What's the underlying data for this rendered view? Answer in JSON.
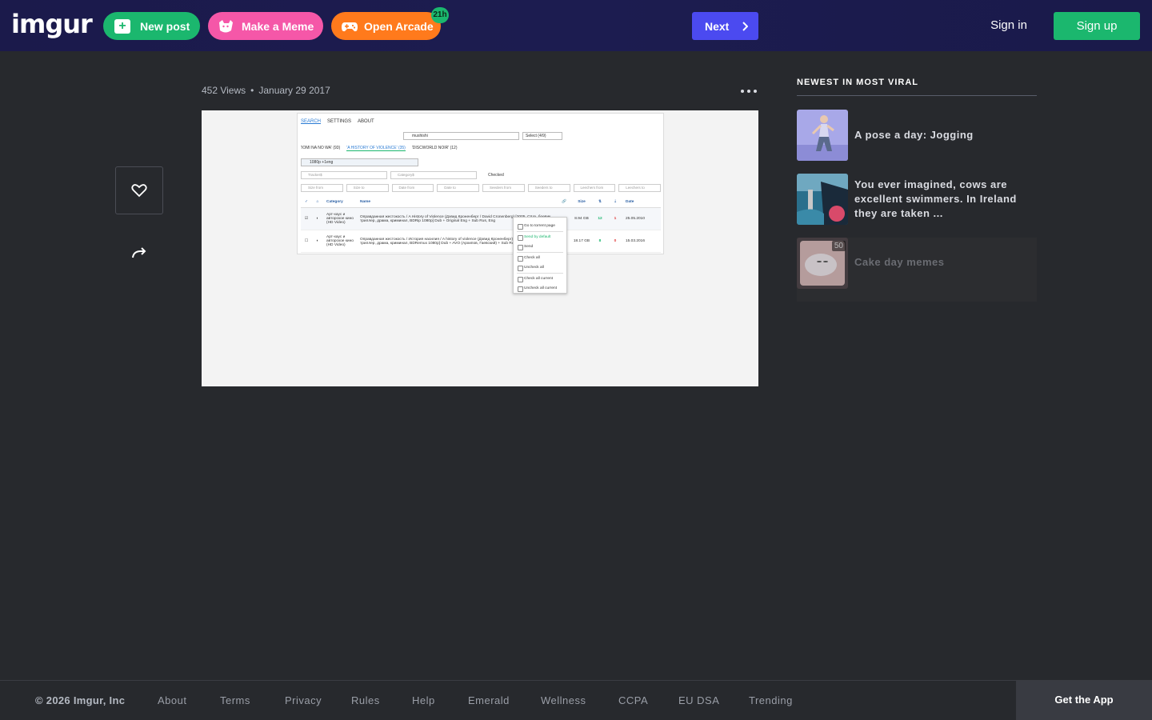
{
  "header": {
    "logo": "imgur",
    "new_post_label": "New post",
    "meme_label": "Make a Meme",
    "arcade_label": "Open Arcade",
    "arcade_badge": "21h",
    "next_label": "Next",
    "signin_label": "Sign in",
    "signup_label": "Sign up"
  },
  "post": {
    "views": "452 Views",
    "separator": "•",
    "date": "January 29 2017",
    "screenshot": {
      "tabs": [
        "SEARCH",
        "SETTINGS",
        "ABOUT"
      ],
      "search_value": "mushishi",
      "select_label": "Select (4/9)",
      "categories": [
        "'IOMI NA NO WA' (93)",
        "'A HISTORY OF VIOLENCE' (35)",
        "'DISCWORLD NOIR' (12)"
      ],
      "filter_value": "1080p +1eng",
      "checked_label": "Checked",
      "filter_row1": [
        "Tracker$",
        "Category$"
      ],
      "filter_row2": [
        "Size from",
        "Size to",
        "Date from",
        "Date to",
        "Seeders from",
        "Seeders to",
        "Leechers from",
        "Leechers to"
      ],
      "columns": [
        "Category",
        "Name",
        "Size",
        "Date"
      ],
      "rows": [
        {
          "category": "Арт-хаус и авторское кино (HD Video)",
          "name": "Оправданная жестокость / A History of Violence (Дэвид Кроненберг / David Cronenberg) [2005, США, боевик, триллер, драма, криминал, BDRip 1080p] Dub + Original Eng + Sub Rus, Eng",
          "size": "8.94 GB",
          "seeds": "12",
          "leech": "1",
          "date": "25.05.2010"
        },
        {
          "category": "Арт-хаус и авторское кино (HD Video)",
          "name": "Оправданная жестокость / История насилия / A history of violence (Дэвид Кроненберг) [2005, США, Германия, триллер, драма, криминал, BDRemux 1080p] Dub + AVO (Архипов, Гаевский) + Sub Rus, Eng + Original Eng",
          "size": "18.17 GB",
          "seeds": "8",
          "leech": "0",
          "date": "15.03.2016"
        }
      ],
      "context_menu": [
        "Go to torrent page",
        "Send by default",
        "Send",
        "Check all",
        "Uncheck all",
        "Check all current",
        "Uncheck all current"
      ]
    }
  },
  "sidebar": {
    "title": "NEWEST IN MOST VIRAL",
    "items": [
      {
        "title": "A pose a day: Jogging"
      },
      {
        "title": "You ever imagined, cows are excellent swimmers. In Ireland they are taken ..."
      },
      {
        "title": "Cake day memes",
        "count": "50"
      }
    ]
  },
  "footer": {
    "copyright": "© 2026 Imgur, Inc",
    "links": [
      "About",
      "Terms",
      "Privacy",
      "Rules",
      "Help",
      "Emerald",
      "Wellness",
      "CCPA",
      "EU DSA",
      "Trending"
    ],
    "get_app": "Get the App"
  }
}
